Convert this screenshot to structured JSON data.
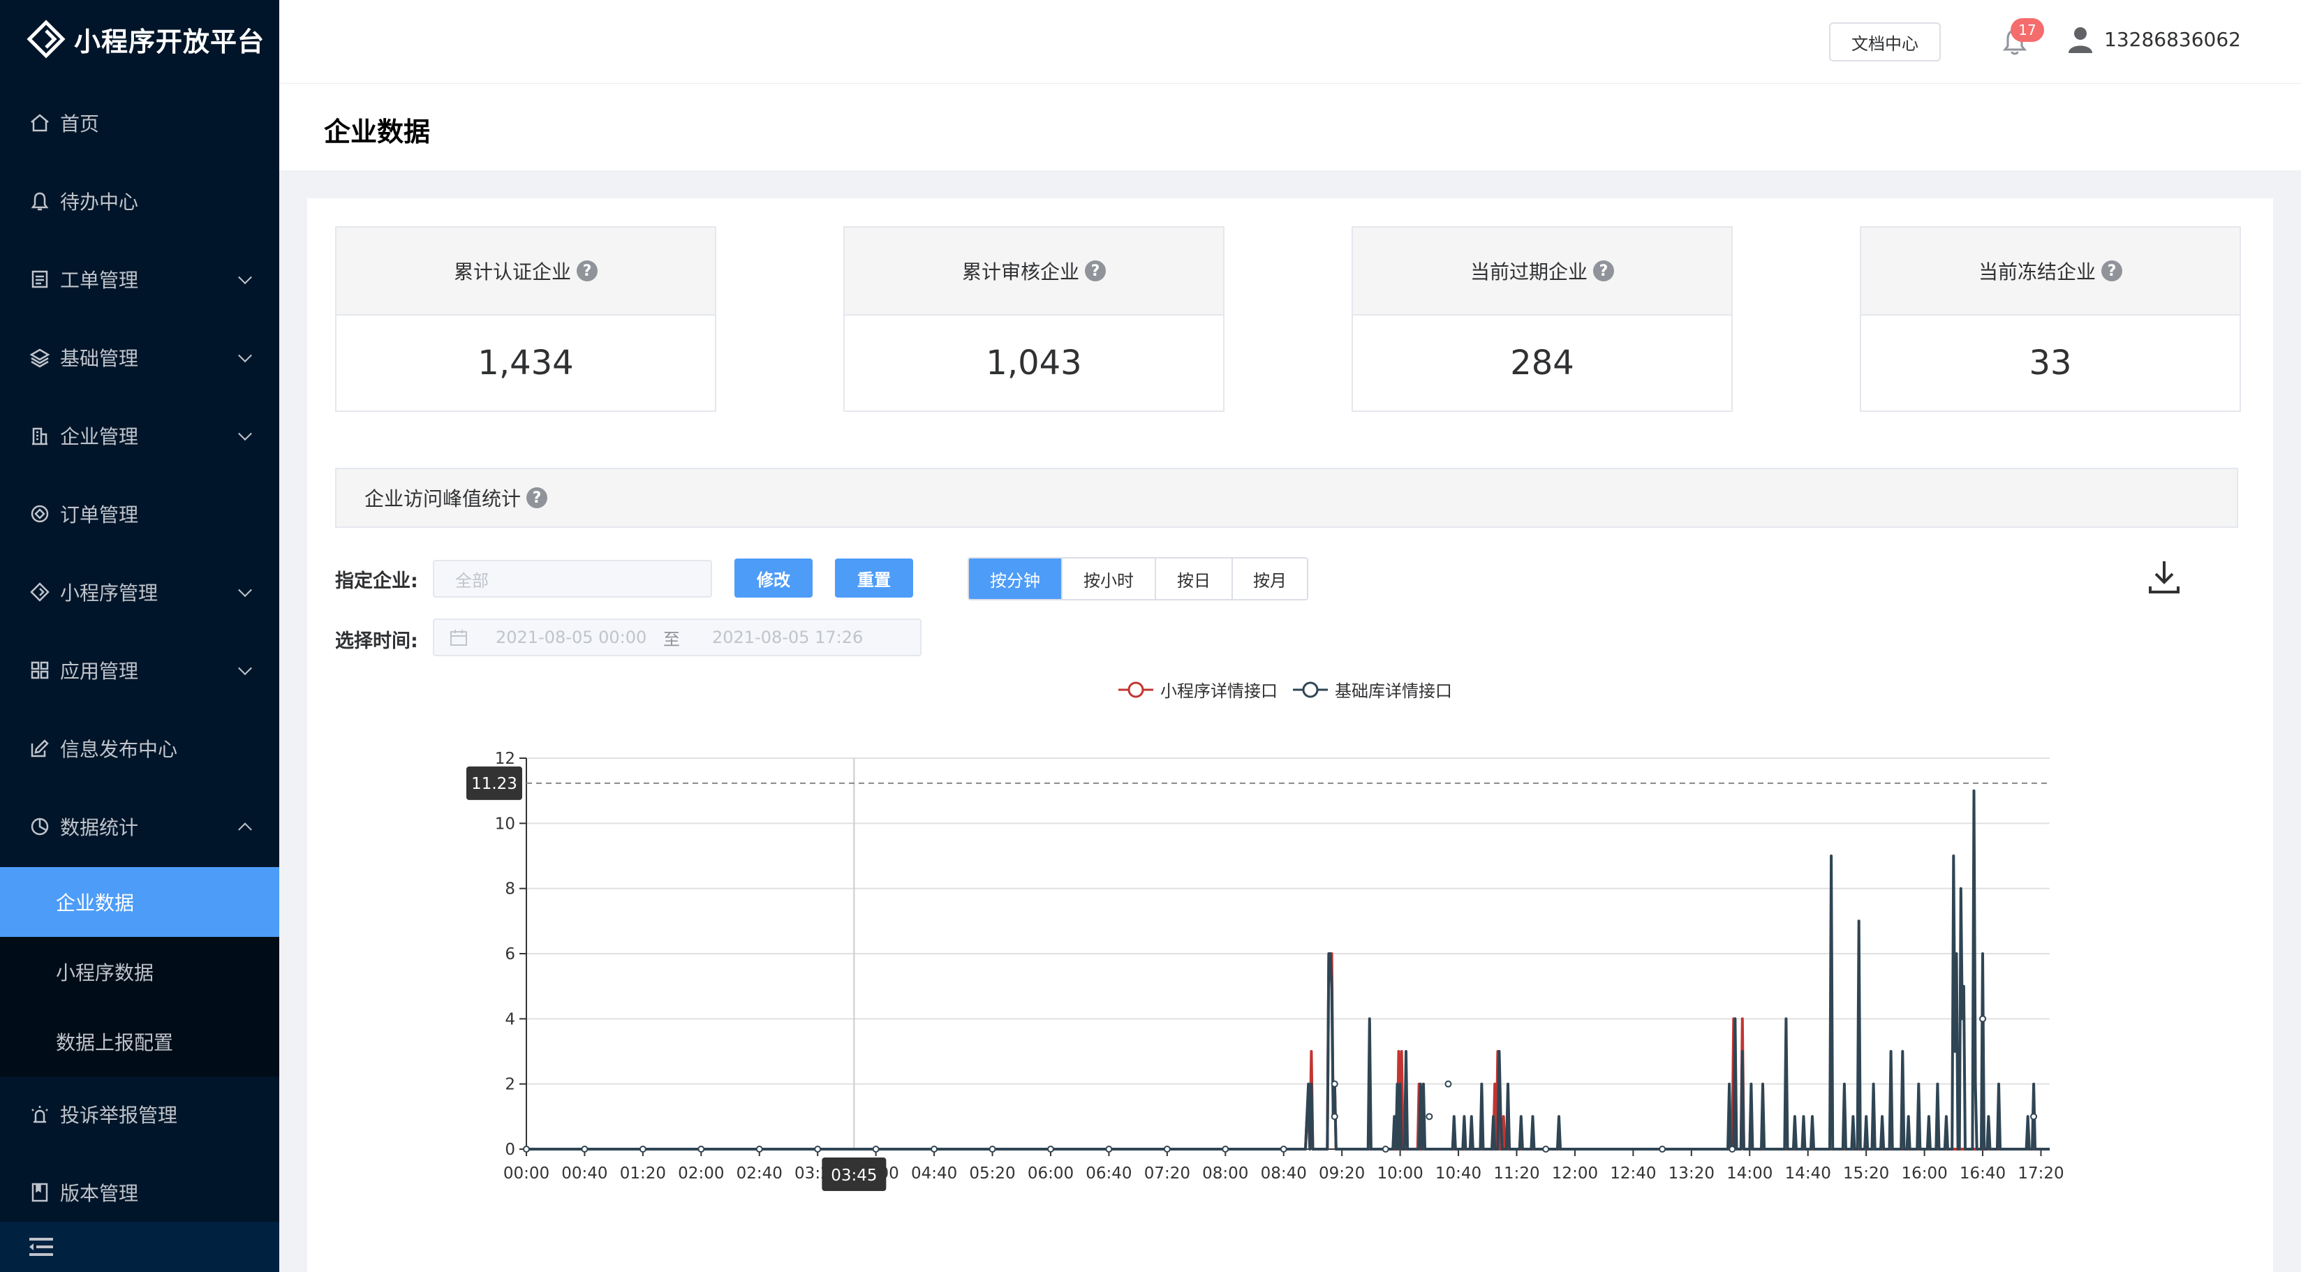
{
  "app": {
    "title": "小程序开放平台"
  },
  "sidebar": {
    "items": [
      {
        "label": "首页",
        "icon": "home-icon",
        "expandable": false
      },
      {
        "label": "待办中心",
        "icon": "bell-icon",
        "expandable": false
      },
      {
        "label": "工单管理",
        "icon": "ticket-icon",
        "expandable": true
      },
      {
        "label": "基础管理",
        "icon": "layers-icon",
        "expandable": true
      },
      {
        "label": "企业管理",
        "icon": "building-icon",
        "expandable": true
      },
      {
        "label": "订单管理",
        "icon": "order-icon",
        "expandable": false
      },
      {
        "label": "小程序管理",
        "icon": "diamond-icon",
        "expandable": true
      },
      {
        "label": "应用管理",
        "icon": "grid-icon",
        "expandable": true
      },
      {
        "label": "信息发布中心",
        "icon": "edit-icon",
        "expandable": false
      },
      {
        "label": "数据统计",
        "icon": "pie-icon",
        "expandable": true,
        "expanded": true
      },
      {
        "label": "投诉举报管理",
        "icon": "alarm-icon",
        "expandable": false
      },
      {
        "label": "版本管理",
        "icon": "book-icon",
        "expandable": false
      }
    ],
    "sub_items": [
      {
        "label": "企业数据",
        "active": true
      },
      {
        "label": "小程序数据",
        "active": false
      },
      {
        "label": "数据上报配置",
        "active": false
      }
    ],
    "collapse_icon": "menu-fold-icon"
  },
  "header": {
    "doc_button": "文档中心",
    "notification_count": "17",
    "username": "13286836062"
  },
  "page": {
    "title": "企业数据"
  },
  "stats": [
    {
      "label": "累计认证企业",
      "value": "1,434"
    },
    {
      "label": "累计审核企业",
      "value": "1,043"
    },
    {
      "label": "当前过期企业",
      "value": "284"
    },
    {
      "label": "当前冻结企业",
      "value": "33"
    }
  ],
  "section": {
    "title": "企业访问峰值统计"
  },
  "filters": {
    "enterprise_label": "指定企业:",
    "enterprise_placeholder": "全部",
    "modify_button": "修改",
    "reset_button": "重置",
    "time_label": "选择时间:",
    "start_time": "2021-08-05 00:00",
    "separator": "至",
    "end_time": "2021-08-05 17:26",
    "granularity": [
      "按分钟",
      "按小时",
      "按日",
      "按月"
    ],
    "granularity_selected": 0
  },
  "colors": {
    "accent": "#4d9cf8",
    "series_red": "#c23531",
    "series_dark": "#2f4554",
    "sidebar_bg": "#001529"
  },
  "chart_data": {
    "type": "line",
    "legend": [
      "小程序详情接口",
      "基础库详情接口"
    ],
    "ylim": [
      0,
      12
    ],
    "yticks": [
      0,
      2,
      4,
      6,
      8,
      10,
      12
    ],
    "x_range_minutes": [
      0,
      1046
    ],
    "xtick_labels": [
      "00:00",
      "00:40",
      "01:20",
      "02:00",
      "02:40",
      "03:20",
      "04:00",
      "04:40",
      "05:20",
      "06:00",
      "06:40",
      "07:20",
      "08:00",
      "08:40",
      "09:20",
      "10:00",
      "10:40",
      "11:20",
      "12:00",
      "12:40",
      "13:20",
      "14:00",
      "14:40",
      "15:20",
      "16:00",
      "16:40",
      "17:20"
    ],
    "tooltip": {
      "x_label": "03:45",
      "y_label": "11.23",
      "y_value": 11.23
    },
    "series": [
      {
        "name": "小程序详情接口",
        "points": [
          [
            0,
            0
          ],
          [
            535,
            0
          ],
          [
            536,
            1
          ],
          [
            537,
            1
          ],
          [
            538,
            0
          ],
          [
            539,
            3
          ],
          [
            540,
            0
          ],
          [
            550,
            0
          ],
          [
            551,
            6
          ],
          [
            552,
            6
          ],
          [
            553,
            6
          ],
          [
            554,
            1
          ],
          [
            555,
            2
          ],
          [
            556,
            0
          ],
          [
            598,
            0
          ],
          [
            599,
            3
          ],
          [
            600,
            0
          ],
          [
            601,
            3
          ],
          [
            602,
            0
          ],
          [
            612,
            0
          ],
          [
            613,
            2
          ],
          [
            614,
            0
          ],
          [
            664,
            0
          ],
          [
            665,
            2
          ],
          [
            666,
            0
          ],
          [
            667,
            3
          ],
          [
            668,
            0
          ],
          [
            670,
            0
          ],
          [
            671,
            1
          ],
          [
            672,
            0
          ],
          [
            828,
            0
          ],
          [
            829,
            4
          ],
          [
            830,
            0
          ],
          [
            834,
            0
          ],
          [
            835,
            4
          ],
          [
            836,
            0
          ],
          [
            1060,
            0
          ],
          [
            1046,
            0
          ]
        ]
      },
      {
        "name": "基础库详情接口",
        "points": [
          [
            0,
            0
          ],
          [
            535,
            0
          ],
          [
            536,
            1
          ],
          [
            537,
            2
          ],
          [
            538,
            0
          ],
          [
            539,
            2
          ],
          [
            540,
            0
          ],
          [
            550,
            0
          ],
          [
            551,
            6
          ],
          [
            552,
            6
          ],
          [
            553,
            5
          ],
          [
            554,
            1
          ],
          [
            555,
            2
          ],
          [
            556,
            0
          ],
          [
            578,
            0
          ],
          [
            579,
            4
          ],
          [
            580,
            0
          ],
          [
            595,
            0
          ],
          [
            596,
            1
          ],
          [
            597,
            0
          ],
          [
            598,
            2
          ],
          [
            599,
            0
          ],
          [
            600,
            2
          ],
          [
            601,
            0
          ],
          [
            603,
            0
          ],
          [
            604,
            3
          ],
          [
            605,
            0
          ],
          [
            613,
            0
          ],
          [
            614,
            2
          ],
          [
            615,
            0
          ],
          [
            616,
            2
          ],
          [
            617,
            0
          ],
          [
            636,
            0
          ],
          [
            637,
            1
          ],
          [
            638,
            0
          ],
          [
            643,
            0
          ],
          [
            644,
            1
          ],
          [
            645,
            0
          ],
          [
            648,
            0
          ],
          [
            649,
            1
          ],
          [
            650,
            0
          ],
          [
            655,
            0
          ],
          [
            656,
            2
          ],
          [
            657,
            0
          ],
          [
            663,
            0
          ],
          [
            664,
            1
          ],
          [
            665,
            0
          ],
          [
            667,
            0
          ],
          [
            668,
            3
          ],
          [
            669,
            1
          ],
          [
            670,
            0
          ],
          [
            673,
            0
          ],
          [
            674,
            2
          ],
          [
            675,
            0
          ],
          [
            682,
            0
          ],
          [
            683,
            1
          ],
          [
            684,
            0
          ],
          [
            690,
            0
          ],
          [
            691,
            1
          ],
          [
            692,
            0
          ],
          [
            708,
            0
          ],
          [
            709,
            1
          ],
          [
            710,
            0
          ],
          [
            711,
            0
          ],
          [
            825,
            0
          ],
          [
            826,
            2
          ],
          [
            827,
            0
          ],
          [
            829,
            0
          ],
          [
            830,
            4
          ],
          [
            831,
            0
          ],
          [
            834,
            0
          ],
          [
            835,
            3
          ],
          [
            836,
            0
          ],
          [
            840,
            0
          ],
          [
            841,
            2
          ],
          [
            842,
            0
          ],
          [
            848,
            0
          ],
          [
            849,
            2
          ],
          [
            850,
            0
          ],
          [
            864,
            0
          ],
          [
            865,
            4
          ],
          [
            866,
            0
          ],
          [
            870,
            0
          ],
          [
            871,
            1
          ],
          [
            872,
            0
          ],
          [
            876,
            0
          ],
          [
            877,
            1
          ],
          [
            878,
            0
          ],
          [
            882,
            0
          ],
          [
            883,
            1
          ],
          [
            884,
            0
          ],
          [
            895,
            0
          ],
          [
            896,
            9
          ],
          [
            897,
            0
          ],
          [
            904,
            0
          ],
          [
            905,
            2
          ],
          [
            906,
            0
          ],
          [
            910,
            0
          ],
          [
            911,
            1
          ],
          [
            912,
            0
          ],
          [
            914,
            0
          ],
          [
            915,
            7
          ],
          [
            916,
            0
          ],
          [
            919,
            0
          ],
          [
            920,
            1
          ],
          [
            921,
            0
          ],
          [
            924,
            0
          ],
          [
            925,
            2
          ],
          [
            926,
            0
          ],
          [
            930,
            0
          ],
          [
            931,
            1
          ],
          [
            932,
            0
          ],
          [
            936,
            0
          ],
          [
            937,
            3
          ],
          [
            938,
            0
          ],
          [
            944,
            0
          ],
          [
            945,
            3
          ],
          [
            946,
            0
          ],
          [
            948,
            0
          ],
          [
            949,
            1
          ],
          [
            950,
            0
          ],
          [
            955,
            0
          ],
          [
            956,
            2
          ],
          [
            957,
            0
          ],
          [
            962,
            0
          ],
          [
            963,
            1
          ],
          [
            964,
            0
          ],
          [
            968,
            0
          ],
          [
            969,
            2
          ],
          [
            970,
            0
          ],
          [
            974,
            0
          ],
          [
            975,
            1
          ],
          [
            976,
            0
          ],
          [
            979,
            0
          ],
          [
            980,
            9
          ],
          [
            981,
            3
          ],
          [
            982,
            6
          ],
          [
            983,
            0
          ],
          [
            984,
            0
          ],
          [
            985,
            8
          ],
          [
            986,
            4
          ],
          [
            987,
            5
          ],
          [
            988,
            0
          ],
          [
            993,
            0
          ],
          [
            994,
            11
          ],
          [
            995,
            2
          ],
          [
            996,
            0
          ],
          [
            999,
            0
          ],
          [
            1000,
            6
          ],
          [
            1001,
            0
          ],
          [
            1003,
            0
          ],
          [
            1004,
            1
          ],
          [
            1005,
            0
          ],
          [
            1010,
            0
          ],
          [
            1011,
            2
          ],
          [
            1012,
            0
          ],
          [
            1030,
            0
          ],
          [
            1031,
            1
          ],
          [
            1032,
            0
          ],
          [
            1034,
            0
          ],
          [
            1035,
            2
          ],
          [
            1036,
            0
          ],
          [
            1046,
            0
          ]
        ]
      }
    ]
  }
}
